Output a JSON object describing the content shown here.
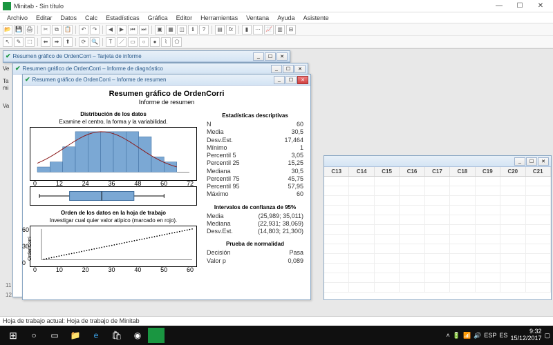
{
  "app": {
    "title": "Minitab - Sin título"
  },
  "menu": [
    "Archivo",
    "Editar",
    "Datos",
    "Calc",
    "Estadísticas",
    "Gráfica",
    "Editor",
    "Herramientas",
    "Ventana",
    "Ayuda",
    "Asistente"
  ],
  "windows": {
    "card": "Resumen gráfico de OrdenCorri – Tarjeta de informe",
    "diag": "Resumen gráfico de OrdenCorri – Informe de diagnóstico",
    "summary": "Resumen gráfico de OrdenCorri – Informe de resumen"
  },
  "report": {
    "title": "Resumen gráfico de OrdenCorri",
    "subtitle": "Informe de resumen",
    "dist_title": "Distribución de los datos",
    "dist_sub": "Examine el centro, la forma y la variabilidad.",
    "order_title": "Orden de los datos en la hoja de trabajo",
    "order_sub": "Investigar cual quier valor atípico (marcado en rojo).",
    "ylab_order": "OrdenCorri",
    "x_hist": [
      "0",
      "12",
      "24",
      "36",
      "48",
      "60",
      "72"
    ],
    "x_order": [
      "0",
      "10",
      "20",
      "30",
      "40",
      "50",
      "60"
    ],
    "y_order": [
      "0",
      "30",
      "60"
    ]
  },
  "chart_data": {
    "histogram": {
      "type": "bar",
      "bin_edges": [
        0,
        6,
        12,
        18,
        24,
        30,
        36,
        42,
        48,
        54,
        60,
        66
      ],
      "counts": [
        1,
        2,
        5,
        8,
        8,
        8,
        8,
        8,
        7,
        3,
        2
      ],
      "overlay": "normal_curve",
      "mu": 30.5,
      "sigma": 17.464,
      "xlim": [
        0,
        72
      ]
    },
    "boxplot": {
      "type": "boxplot",
      "min": 1,
      "q1": 15.25,
      "median": 30.5,
      "q3": 45.75,
      "max": 60
    },
    "order_plot": {
      "type": "scatter",
      "x_range": [
        1,
        60
      ],
      "y_range": [
        1,
        60
      ],
      "n_points": 60,
      "pattern": "monotone_increasing",
      "ylim": [
        0,
        60
      ],
      "xlim": [
        0,
        60
      ]
    }
  },
  "stats": {
    "head_desc": "Estadísticas descriptivas",
    "rows_desc": [
      {
        "k": "N",
        "v": "60"
      },
      {
        "k": "Media",
        "v": "30,5"
      },
      {
        "k": "Desv.Est.",
        "v": "17,464"
      },
      {
        "k": "Mínimo",
        "v": "1"
      },
      {
        "k": "Percentil 5",
        "v": "3,05"
      },
      {
        "k": "Percentil 25",
        "v": "15,25"
      },
      {
        "k": "Mediana",
        "v": "30,5"
      },
      {
        "k": "Percentil 75",
        "v": "45,75"
      },
      {
        "k": "Percentil 95",
        "v": "57,95"
      },
      {
        "k": "Máximo",
        "v": "60"
      }
    ],
    "head_ci": "Intervalos de confianza de 95%",
    "rows_ci": [
      {
        "k": "Media",
        "v": "(25,989; 35,011)"
      },
      {
        "k": "Mediana",
        "v": "(22,931; 38,069)"
      },
      {
        "k": "Desv.Est.",
        "v": "(14,803; 21,300)"
      }
    ],
    "head_norm": "Prueba de normalidad",
    "rows_norm": [
      {
        "k": "Decisión",
        "v": "Pasa"
      },
      {
        "k": "Valor p",
        "v": "0,089"
      }
    ]
  },
  "worksheet_cols": [
    "C13",
    "C14",
    "C15",
    "C16",
    "C17",
    "C18",
    "C19",
    "C20",
    "C21"
  ],
  "statusbar": "Hoja de trabajo actual: Hoja de trabajo de Minitab",
  "tray": {
    "lang": "ESP",
    "kbd": "ES",
    "time": "9:32",
    "date": "15/12/2017"
  },
  "left_labels": {
    "ve": "Ve",
    "ta": "Ta",
    "mi": "mi",
    "va": "Va",
    "r11": "11",
    "r12": "12"
  }
}
